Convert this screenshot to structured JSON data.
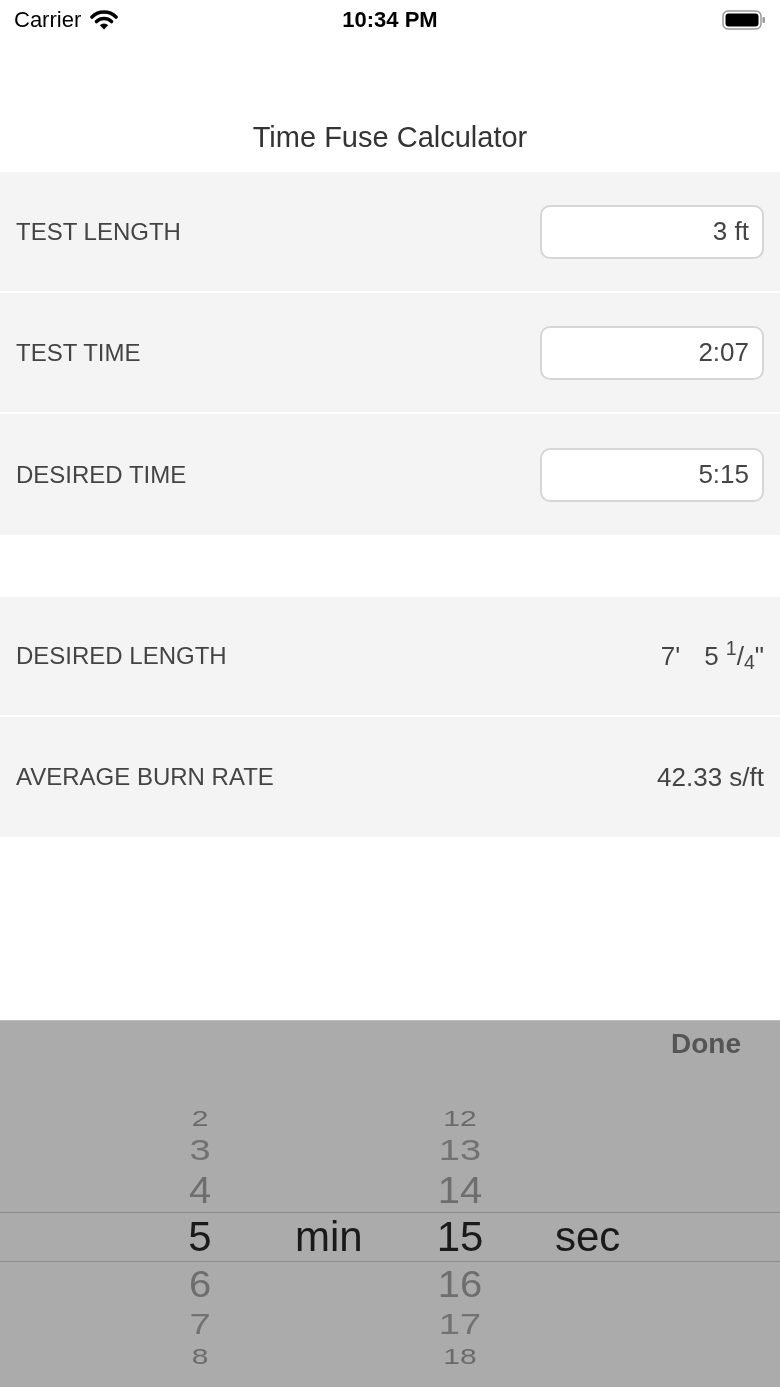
{
  "status_bar": {
    "carrier": "Carrier",
    "time": "10:34 PM"
  },
  "nav_bar": {
    "title": "Time Fuse Calculator"
  },
  "inputs": [
    {
      "label": "TEST LENGTH",
      "value": "3 ft"
    },
    {
      "label": "TEST TIME",
      "value": "2:07"
    },
    {
      "label": "DESIRED TIME",
      "value": "5:15"
    }
  ],
  "results": [
    {
      "label": "DESIRED LENGTH",
      "values": [
        "7'",
        "5 $^{1}$/$_{4}$\""
      ]
    },
    {
      "label": "AVERAGE BURN RATE",
      "values": [
        "42.33 s/ft"
      ]
    }
  ],
  "picker": {
    "done": "Done",
    "columns": [
      {
        "kind": "wheel",
        "items": [
          {
            "text": "2",
            "selected": false
          },
          {
            "text": "3",
            "selected": false
          },
          {
            "text": "4",
            "selected": false
          },
          {
            "text": "5",
            "selected": true
          },
          {
            "text": "6",
            "selected": false
          },
          {
            "text": "7",
            "selected": false
          },
          {
            "text": "8",
            "selected": false
          }
        ]
      },
      {
        "kind": "unit",
        "label": "min"
      },
      {
        "kind": "wheel",
        "items": [
          {
            "text": "12",
            "selected": false
          },
          {
            "text": "13",
            "selected": false
          },
          {
            "text": "14",
            "selected": false
          },
          {
            "text": "15",
            "selected": true
          },
          {
            "text": "16",
            "selected": false
          },
          {
            "text": "17",
            "selected": false
          },
          {
            "text": "18",
            "selected": false
          }
        ]
      },
      {
        "kind": "unit",
        "label": "sec"
      }
    ]
  }
}
